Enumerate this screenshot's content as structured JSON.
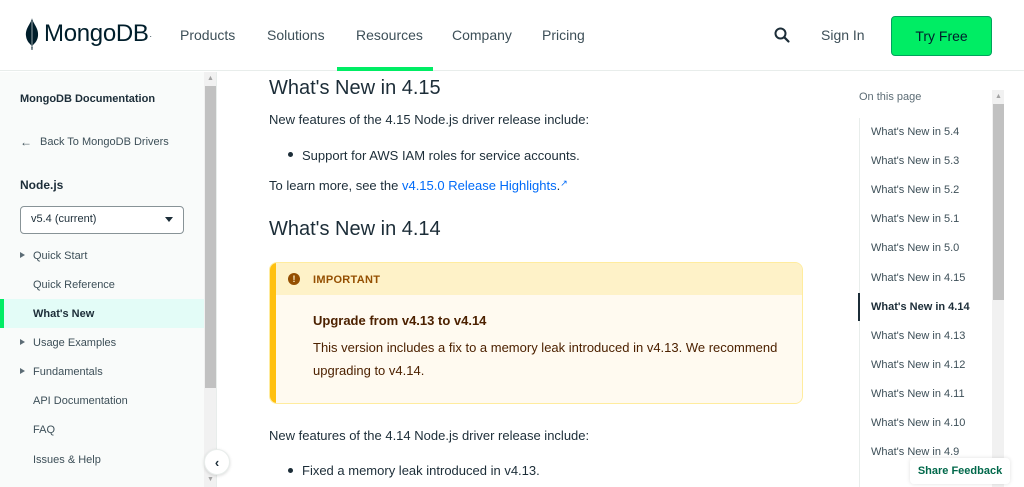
{
  "header": {
    "logo_text": "MongoDB",
    "logo_reg": ".",
    "nav": [
      "Products",
      "Solutions",
      "Resources",
      "Company",
      "Pricing"
    ],
    "active_nav": "Resources",
    "search_icon": "search-icon",
    "sign_in": "Sign In",
    "try_free": "Try Free",
    "accent_color": "#00ed64"
  },
  "sidebar": {
    "title": "MongoDB Documentation",
    "back_link": "Back To MongoDB Drivers",
    "section": "Node.js",
    "version": "v5.4 (current)",
    "items": [
      {
        "label": "Quick Start",
        "expandable": true
      },
      {
        "label": "Quick Reference",
        "expandable": false
      },
      {
        "label": "What's New",
        "expandable": false,
        "active": true
      },
      {
        "label": "Usage Examples",
        "expandable": true
      },
      {
        "label": "Fundamentals",
        "expandable": true
      },
      {
        "label": "API Documentation",
        "expandable": false
      },
      {
        "label": "FAQ",
        "expandable": false
      },
      {
        "label": "Issues & Help",
        "expandable": false
      }
    ]
  },
  "main": {
    "h_415": "What's New in 4.15",
    "p_415": "New features of the 4.15 Node.js driver release include:",
    "li_415": "Support for AWS IAM roles for service accounts.",
    "learn_more_prefix": "To learn more, see the ",
    "learn_more_link": "v4.15.0 Release Highlights",
    "learn_more_suffix": ".",
    "h_414": "What's New in 4.14",
    "callout": {
      "label": "IMPORTANT",
      "title": "Upgrade from v4.13 to v4.14",
      "text": "This version includes a fix to a memory leak introduced in v4.13. We recommend upgrading to v4.14."
    },
    "p_414": "New features of the 4.14 Node.js driver release include:",
    "li_414": "Fixed a memory leak introduced in v4.13."
  },
  "toc": {
    "heading": "On this page",
    "items": [
      "What's New in 5.4",
      "What's New in 5.3",
      "What's New in 5.2",
      "What's New in 5.1",
      "What's New in 5.0",
      "What's New in 4.15",
      "What's New in 4.14",
      "What's New in 4.13",
      "What's New in 4.12",
      "What's New in 4.11",
      "What's New in 4.10",
      "What's New in 4.9"
    ],
    "active": "What's New in 4.14"
  },
  "feedback": "Share Feedback"
}
